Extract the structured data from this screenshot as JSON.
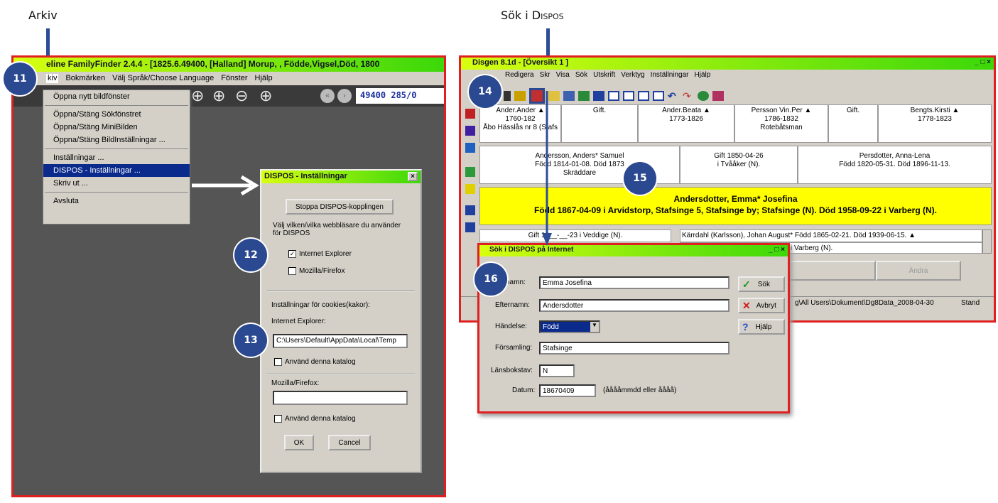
{
  "captions": {
    "left": "Arkiv",
    "right_prefix": "Sök i ",
    "right_smallcaps": "Dispos"
  },
  "badges": {
    "b11": "11",
    "b12": "12",
    "b13": "13",
    "b14": "14",
    "b15": "15",
    "b16": "16"
  },
  "ff": {
    "title": "eline FamilyFinder 2.4.4 - [1825.6.49400,  [Halland]  Morup,  ,  Födde,Vigsel,Död, 1800",
    "menu": [
      "kiv",
      "Bokmärken",
      "Välj Språk/Choose Language",
      "Fönster",
      "Hjälp"
    ],
    "toolbar_value": "49400  285/0",
    "dropdown": [
      "Öppna nytt bildfönster",
      "Öppna/Stäng Sökfönstret",
      "Öppna/Stäng MiniBilden",
      "Öppna/Stäng BildInställningar ...",
      "Inställningar ...",
      "DISPOS - Inställningar ...",
      "Skriv ut ...",
      "Avsluta"
    ]
  },
  "dispos": {
    "title": "DISPOS - Inställningar",
    "close": "×",
    "stop_button": "Stoppa DISPOS-kopplingen",
    "browser_text": "Välj vilken/vilka webbläsare du använder för DISPOS",
    "ie_label": "Internet Explorer",
    "ff_label": "Mozilla/Firefox",
    "cookies_label": "Inställningar för cookies(kakor):",
    "ie_path_label": "Internet Explorer:",
    "ie_path_value": "C:\\Users\\Default\\AppData\\Local\\Temp",
    "use_dir": "Använd denna katalog",
    "mozilla_label": "Mozilla/Firefox:",
    "mozilla_value": "",
    "ok": "OK",
    "cancel": "Cancel"
  },
  "disgen": {
    "title": "Disgen 8.1d - [Översikt 1 ]",
    "winbtns": "_ □ ×",
    "menu": [
      "Redigera",
      "Skr",
      "Visa",
      "Sök",
      "Utskrift",
      "Verktyg",
      "Inställningar",
      "Hjälp"
    ],
    "row1": [
      {
        "l1": "Ander.Ander ▲",
        "l2": "1760-182",
        "l3": "Åbo Hässlås nr 8 (Stafs"
      },
      {
        "l1": "Gift.",
        "l2": "",
        "l3": ""
      },
      {
        "l1": "Ander.Beata ▲",
        "l2": "1773-1826",
        "l3": ""
      },
      {
        "l1": "Persson Vin.Per ▲",
        "l2": "1786-1832",
        "l3": "Rotebåtsman"
      },
      {
        "l1": "Gift.",
        "l2": "",
        "l3": ""
      },
      {
        "l1": "Bengts.Kirsti ▲",
        "l2": "1778-1823",
        "l3": ""
      }
    ],
    "row2": [
      {
        "l1": "Andersson, Anders* Samuel",
        "l2": "Född 1814-01-08. Död 1873",
        "l3": "Skräddare"
      },
      {
        "l1": "Gift 1850-04-26",
        "l2": "i Tvååker (N).",
        "l3": ""
      },
      {
        "l1": "Persdotter, Anna-Lena",
        "l2": "Född 1820-05-31. Död 1896-11-13.",
        "l3": ""
      }
    ],
    "main_name": "Andersdotter, Emma* Josefina",
    "main_info": "Född 1867-04-09 i Arvidstorp, Stafsinge 5, Stafsinge by; Stafsinge (N). Död 1958-09-22 i Varberg (N).",
    "row4_left": "Gift 18__-__-23 i Veddige (N).",
    "row4_right": "Kärrdahl (Karlsson), Johan August* Född 1865-02-21. Död 1939-06-15. ▲",
    "row5_right": "__18 i Varberg (N).",
    "bottom_btn1": "",
    "bottom_btn2": "Ändra",
    "status_path": "g\\All Users\\Dokument\\Dg8Data_2008-04-30",
    "status_stand": "Stand"
  },
  "sok": {
    "title": "Sök i DISPOS på Internet",
    "fornamn_label": "Förnamn:",
    "fornamn_value": "Emma Josefina",
    "efternamn_label": "Efternamn:",
    "efternamn_value": "Andersdotter",
    "handelse_label": "Händelse:",
    "handelse_value": "Född",
    "forsamling_label": "Församling:",
    "forsamling_value": "Stafsinge",
    "lan_label": "Länsbokstav:",
    "lan_value": "N",
    "datum_label": "Datum:",
    "datum_value": "18670409",
    "datum_hint": "(ååååmmdd eller åååå)",
    "sok_btn": "Sök",
    "avbryt_btn": "Avbryt",
    "hjalp_btn": "Hjälp"
  },
  "colors": {
    "brand_blue": "#2b4991",
    "title_green": "#3cd80a",
    "highlight_yellow": "#ffff00",
    "frame_red": "#e02020",
    "dark_bg": "#555555",
    "selection_blue": "#0a2a8c"
  }
}
